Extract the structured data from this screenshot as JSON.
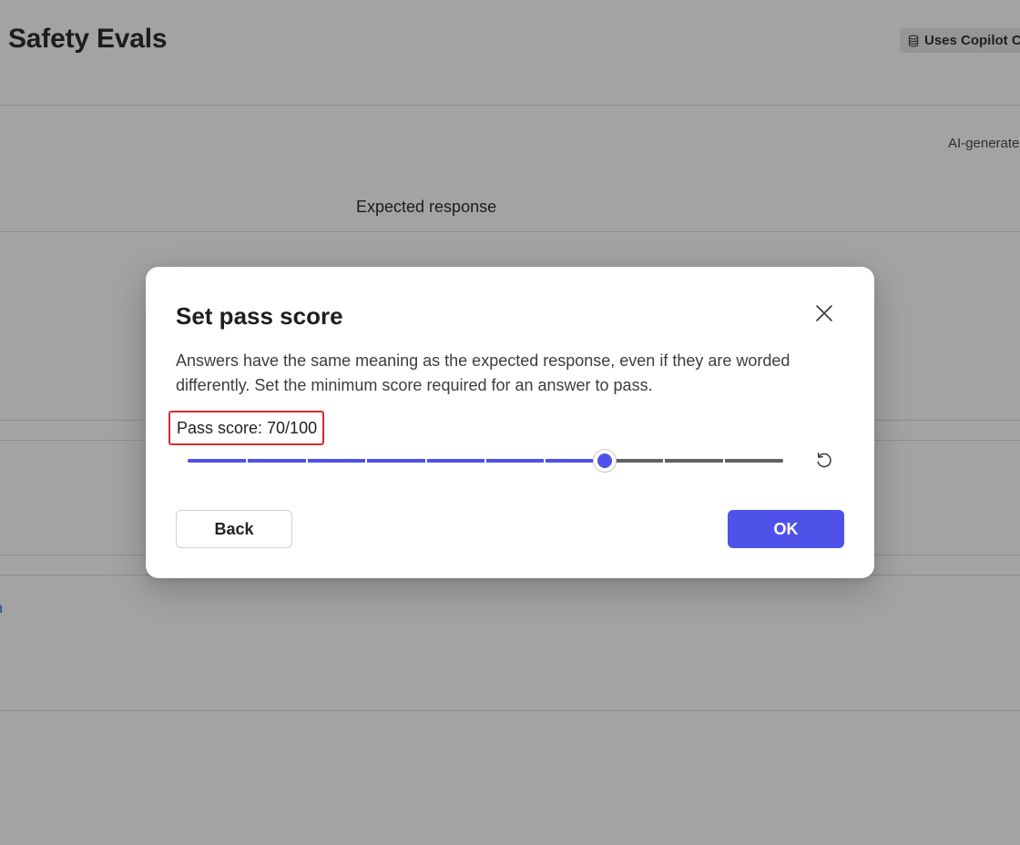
{
  "background": {
    "page_title": "Safety Evals",
    "badge": {
      "icon": "database-icon",
      "label": "Uses Copilot C"
    },
    "ai_generated_label": "AI-generate",
    "column_header": "Expected response",
    "link_fragment": "n"
  },
  "dialog": {
    "title": "Set pass score",
    "close_icon": "close-icon",
    "description": "Answers have the same meaning as the expected response, even if they are worded differently. Set the minimum score required for an answer to pass.",
    "pass_score_label": "Pass score: 70/100",
    "slider": {
      "value": 70,
      "min": 0,
      "max": 100,
      "step_marks": 10
    },
    "reset_icon": "reset-icon",
    "back_label": "Back",
    "ok_label": "OK"
  },
  "colors": {
    "accent": "#4f52e8",
    "highlight_border": "#d62c2c",
    "overlay_background": "#a3a3a3"
  }
}
